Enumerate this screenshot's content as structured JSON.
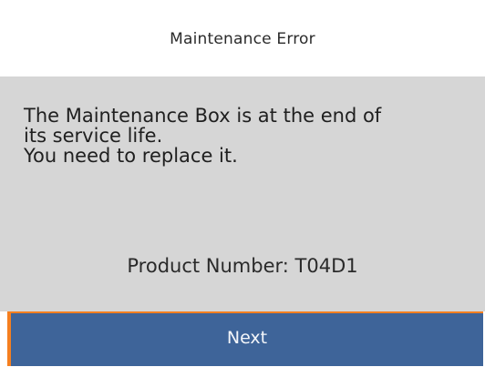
{
  "header": {
    "title": "Maintenance Error"
  },
  "message": {
    "lines": [
      "The Maintenance Box is at the end of",
      "its service life.",
      "You need to replace it."
    ],
    "product_number": "Product Number: T04D1"
  },
  "actions": {
    "next_label": "Next"
  },
  "colors": {
    "panel_background": "#d6d6d6",
    "button_background": "#3e6499",
    "focus_outline": "#f57f20"
  }
}
